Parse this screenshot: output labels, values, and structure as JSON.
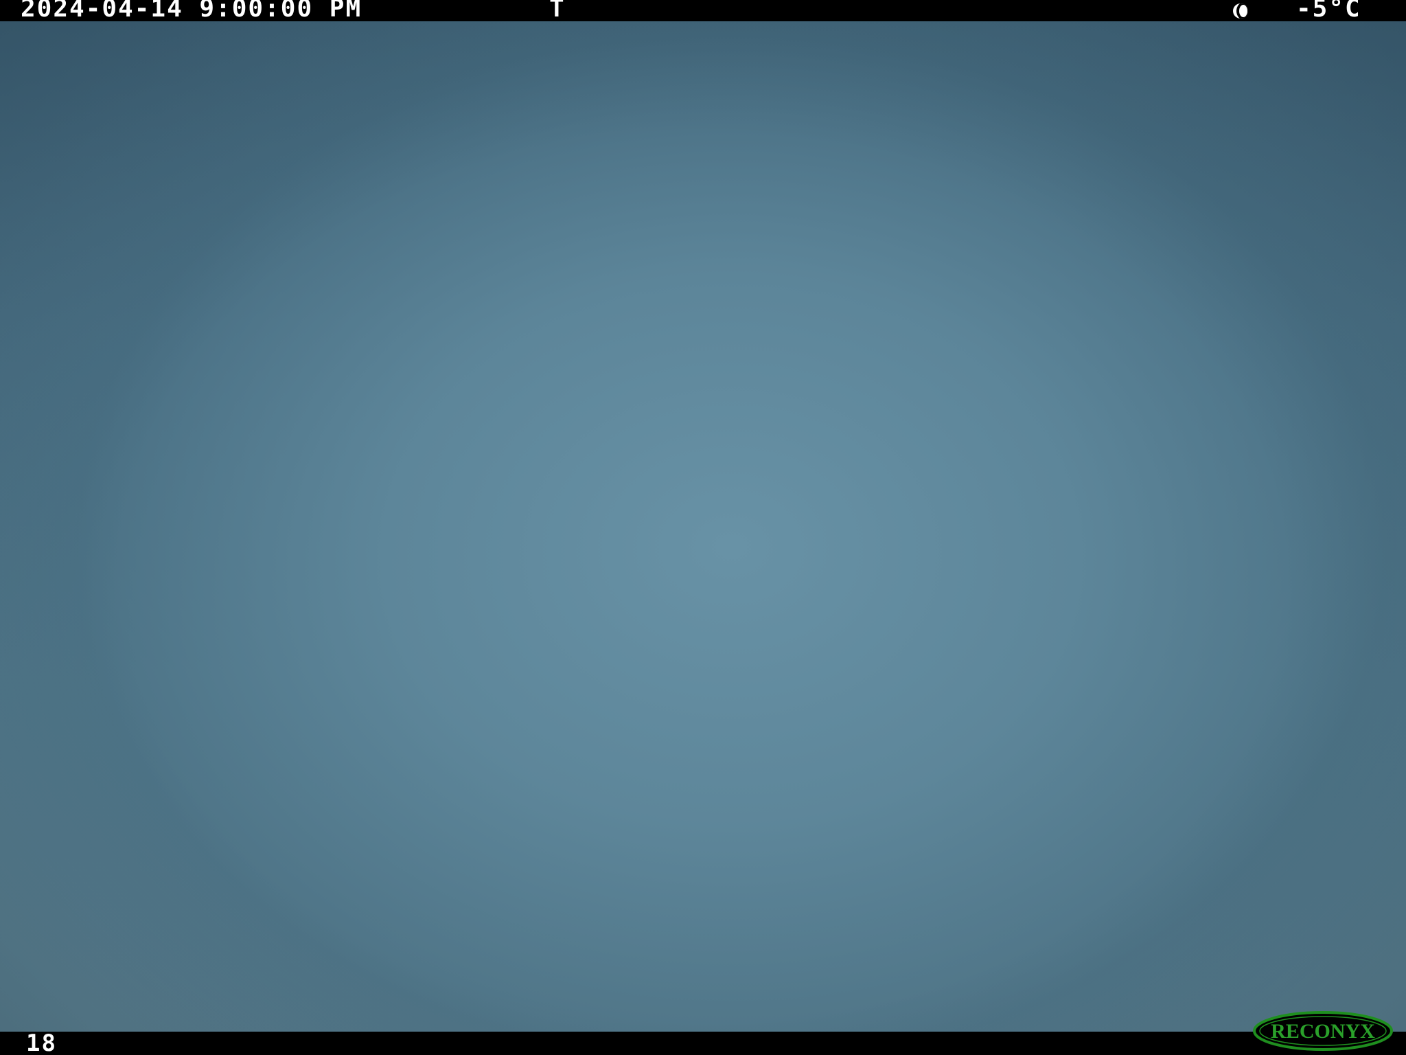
{
  "overlay": {
    "datetime": "2024-04-14 9:00:00 PM",
    "trigger": "T",
    "moon_phase_icon": "waxing-crescent-moon-icon",
    "temperature": "-5°C",
    "frame_number": "18",
    "brand_logo": "RECONYX"
  },
  "colors": {
    "bar_background": "#000000",
    "overlay_text": "#ffffff",
    "sky_center": "#6892a6",
    "sky_edge": "#3f6277",
    "logo_green": "#1f8f1f"
  }
}
